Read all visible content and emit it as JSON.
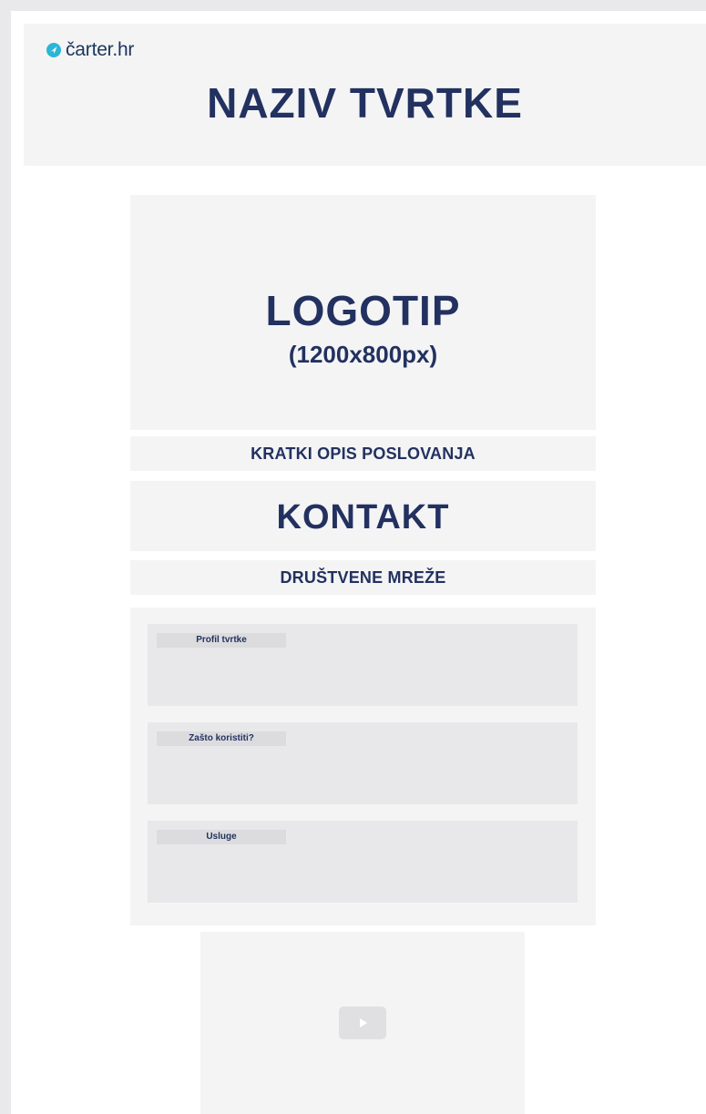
{
  "header": {
    "brand": "čarter.hr",
    "company_name": "NAZIV TVRTKE"
  },
  "logo": {
    "title": "LOGOTIP",
    "size": "(1200x800px)"
  },
  "sections": {
    "description": "KRATKI OPIS POSLOVANJA",
    "contact": "KONTAKT",
    "social": "DRUŠTVENE MREŽE"
  },
  "profile": {
    "cards": [
      {
        "label": "Profil tvrtke"
      },
      {
        "label": "Zašto koristiti?"
      },
      {
        "label": "Usluge"
      }
    ]
  },
  "video": {
    "icon": "play-icon"
  },
  "colors": {
    "background": "#e9e9eb",
    "panel": "#f4f4f5",
    "text": "#22315f",
    "brand_accent": "#2bb6d6"
  }
}
